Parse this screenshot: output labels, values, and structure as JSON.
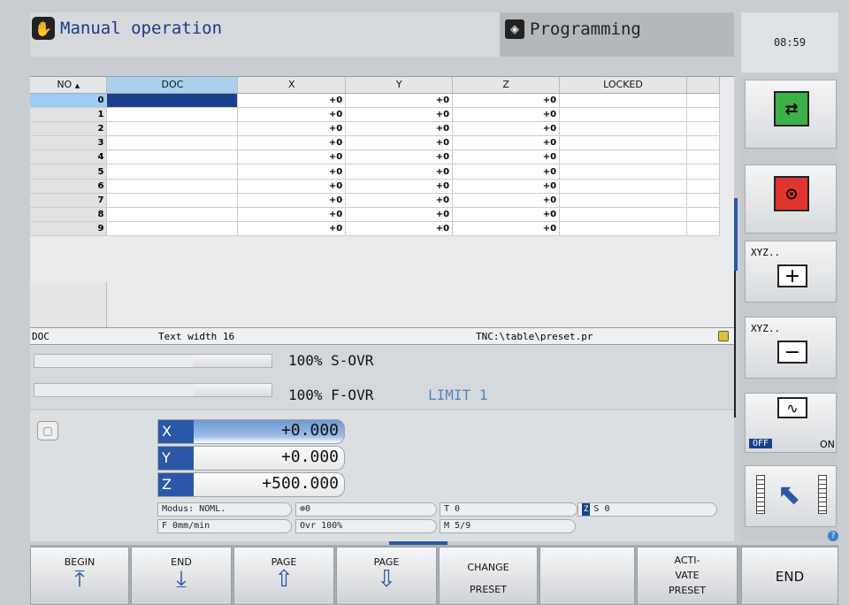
{
  "header": {
    "mode": "Manual operation",
    "mode_icon": "hand-icon",
    "program_mode": "Programming",
    "program_icon": "programming-diamond-icon",
    "clock": "08:59"
  },
  "table": {
    "columns": [
      "NO",
      "DOC",
      "X",
      "Y",
      "Z",
      "LOCKED"
    ],
    "rows": [
      {
        "no": "0",
        "doc": "",
        "x": "+0",
        "y": "+0",
        "z": "+0",
        "locked": ""
      },
      {
        "no": "1",
        "doc": "",
        "x": "+0",
        "y": "+0",
        "z": "+0",
        "locked": ""
      },
      {
        "no": "2",
        "doc": "",
        "x": "+0",
        "y": "+0",
        "z": "+0",
        "locked": ""
      },
      {
        "no": "3",
        "doc": "",
        "x": "+0",
        "y": "+0",
        "z": "+0",
        "locked": ""
      },
      {
        "no": "4",
        "doc": "",
        "x": "+0",
        "y": "+0",
        "z": "+0",
        "locked": ""
      },
      {
        "no": "5",
        "doc": "",
        "x": "+0",
        "y": "+0",
        "z": "+0",
        "locked": ""
      },
      {
        "no": "6",
        "doc": "",
        "x": "+0",
        "y": "+0",
        "z": "+0",
        "locked": ""
      },
      {
        "no": "7",
        "doc": "",
        "x": "+0",
        "y": "+0",
        "z": "+0",
        "locked": ""
      },
      {
        "no": "8",
        "doc": "",
        "x": "+0",
        "y": "+0",
        "z": "+0",
        "locked": ""
      },
      {
        "no": "9",
        "doc": "",
        "x": "+0",
        "y": "+0",
        "z": "+0",
        "locked": ""
      }
    ],
    "selected_row": 0,
    "sort_indicator": "▲"
  },
  "status": {
    "field": "DOC",
    "info": "Text width 16",
    "path": "TNC:\\table\\preset.pr"
  },
  "overrides": {
    "spindle_text": "100% S-OVR",
    "feed_text": "100% F-OVR",
    "spindle_level": 0.67,
    "feed_level": 0.67,
    "limit": "LIMIT 1"
  },
  "position": {
    "axes": [
      {
        "label": "X",
        "value": "+0.000"
      },
      {
        "label": "Y",
        "value": "+0.000"
      },
      {
        "label": "Z",
        "value": "+500.000"
      }
    ],
    "modus": "Modus: NOML.",
    "basic_rot": "0",
    "tool": "T 0",
    "spindle": "S 0",
    "spindle_tag": "Z",
    "feed": "F 0mm/min",
    "ovr": "Ovr 100%",
    "mfunc": "M 5/9"
  },
  "sidebar": {
    "btn1_icon": "program-run-full-icon",
    "btn2_icon": "program-run-single-icon",
    "xyz_plus_label": "XYZ..",
    "xyz_minus_label": "XYZ..",
    "toggle_off": "OFF",
    "toggle_on": "ON",
    "wave_icon": "wave-icon"
  },
  "softkeys": {
    "begin": "BEGIN",
    "end": "END",
    "page_up": "PAGE",
    "page_down": "PAGE",
    "change_preset_1": "CHANGE",
    "change_preset_2": "PRESET",
    "activate_1": "ACTI-",
    "activate_2": "VATE",
    "activate_3": "PRESET",
    "end_main": "END"
  }
}
